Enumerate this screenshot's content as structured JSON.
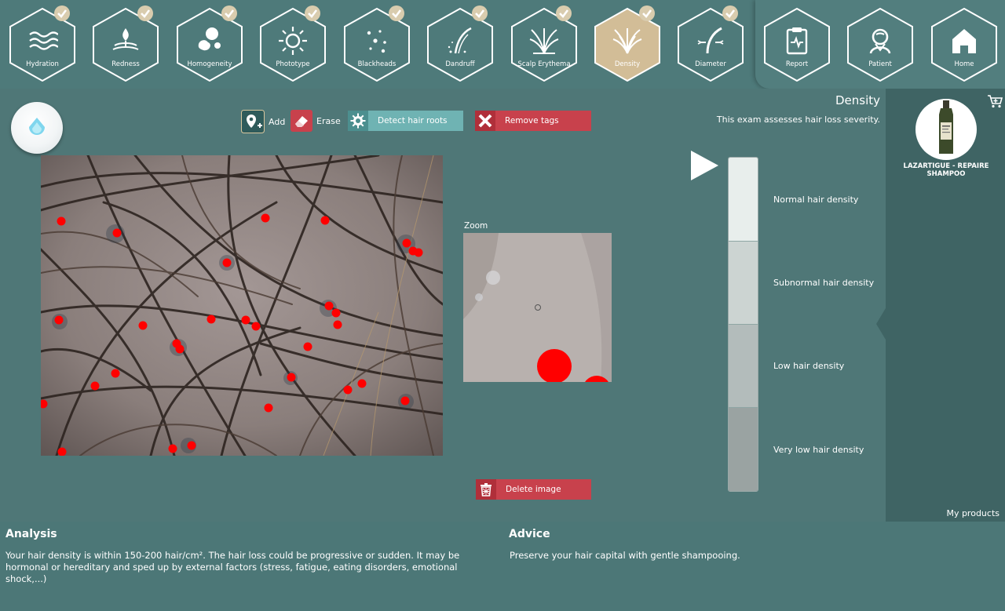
{
  "nav": {
    "items": [
      {
        "label": "Hydration",
        "icon": "waves-icon",
        "done": true,
        "active": false
      },
      {
        "label": "Redness",
        "icon": "drop-flower-icon",
        "done": true,
        "active": false
      },
      {
        "label": "Homogeneity",
        "icon": "blobs-icon",
        "done": true,
        "active": false
      },
      {
        "label": "Phototype",
        "icon": "sun-icon",
        "done": true,
        "active": false
      },
      {
        "label": "Blackheads",
        "icon": "dots-icon",
        "done": true,
        "active": false
      },
      {
        "label": "Dandruff",
        "icon": "hair-flakes-icon",
        "done": true,
        "active": false
      },
      {
        "label": "Scalp Erythema",
        "icon": "hair-tuft-icon",
        "done": true,
        "active": false
      },
      {
        "label": "Density",
        "icon": "hair-density-icon",
        "done": true,
        "active": true
      },
      {
        "label": "Diameter",
        "icon": "hair-strand-icon",
        "done": true,
        "active": false
      }
    ],
    "right_items": [
      {
        "label": "Report",
        "icon": "clipboard-icon"
      },
      {
        "label": "Patient",
        "icon": "patient-icon"
      },
      {
        "label": "Home",
        "icon": "home-icon"
      }
    ]
  },
  "toolbar": {
    "add_label": "Add",
    "erase_label": "Erase",
    "detect_label": "Detect hair roots",
    "remove_label": "Remove tags",
    "delete_label": "Delete image"
  },
  "exam": {
    "title": "Density",
    "description": "This exam assesses hair loss severity."
  },
  "zoom": {
    "label": "Zoom"
  },
  "scale": {
    "levels": [
      {
        "label": "Normal hair density",
        "color": "#e8eeec"
      },
      {
        "label": "Subnormal hair density",
        "color": "#ccd4d2"
      },
      {
        "label": "Low hair density",
        "color": "#b3bcbb"
      },
      {
        "label": "Very low hair density",
        "color": "#9aa3a2"
      }
    ]
  },
  "product": {
    "name": "LAZARTIGUE  -  REPAIRE SHAMPOO",
    "my_products_label": "My products"
  },
  "analysis": {
    "title": "Analysis",
    "text": "Your hair density is within 150-200 hair/cm². The hair loss could be progressive or sudden. It may be hormonal or hereditary and sped up by external factors (stress, fatigue, eating disorders, emotional shock,...)"
  },
  "advice": {
    "title": "Advice",
    "text": "Preserve your hair capital with gentle shampooing."
  },
  "colors": {
    "accent_teal": "#6fb3b3",
    "accent_red": "#c8414c",
    "active_hex": "#d2bd97",
    "tag_red": "#ff0000"
  }
}
